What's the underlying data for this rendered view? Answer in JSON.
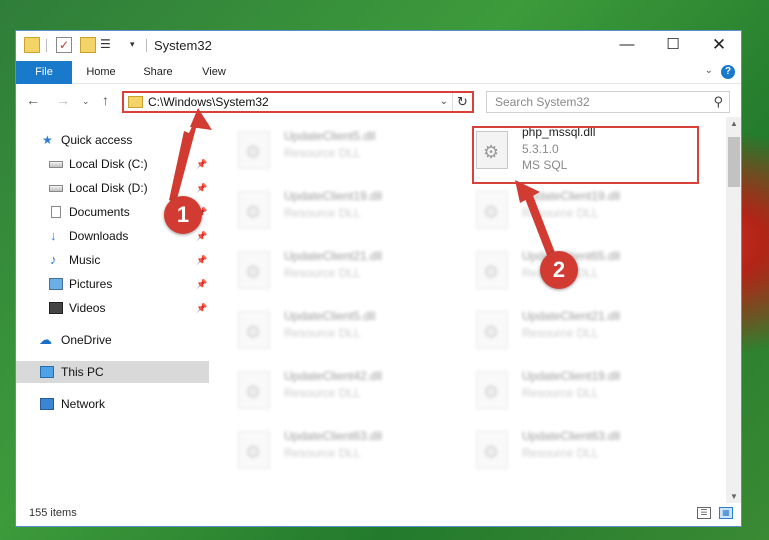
{
  "window": {
    "title": "System32",
    "controls": {
      "minimize": "—",
      "maximize": "☐",
      "close": "✕"
    }
  },
  "ribbon": {
    "tabs": [
      {
        "label": "File"
      },
      {
        "label": "Home"
      },
      {
        "label": "Share"
      },
      {
        "label": "View"
      }
    ],
    "help_label": "?"
  },
  "navigation": {
    "address": "C:\\Windows\\System32",
    "search_placeholder": "Search System32"
  },
  "sidebar": {
    "items": [
      {
        "label": "Quick access",
        "icon": "star-icon"
      },
      {
        "label": "Local Disk (C:)",
        "icon": "disk-icon",
        "pinned": true
      },
      {
        "label": "Local Disk (D:)",
        "icon": "disk-icon",
        "pinned": true
      },
      {
        "label": "Documents",
        "icon": "document-icon",
        "pinned": true
      },
      {
        "label": "Downloads",
        "icon": "download-icon",
        "pinned": true
      },
      {
        "label": "Music",
        "icon": "music-icon",
        "pinned": true
      },
      {
        "label": "Pictures",
        "icon": "pictures-icon",
        "pinned": true
      },
      {
        "label": "Videos",
        "icon": "video-icon",
        "pinned": true
      },
      {
        "label": "OneDrive",
        "icon": "cloud-icon"
      },
      {
        "label": "This PC",
        "icon": "computer-icon",
        "selected": true
      },
      {
        "label": "Network",
        "icon": "network-icon"
      }
    ]
  },
  "files": {
    "highlighted": {
      "name": "php_mssql.dll",
      "version": "5.3.1.0",
      "description": "MS SQL"
    },
    "left_column": [
      {
        "name": "UpdateClient5.dll",
        "type": "Resource DLL"
      },
      {
        "name": "UpdateClient19.dll",
        "type": "Resource DLL"
      },
      {
        "name": "UpdateClient21.dll",
        "type": "Resource DLL"
      },
      {
        "name": "UpdateClient5.dll",
        "type": "Resource DLL"
      },
      {
        "name": "UpdateClient42.dll",
        "type": "Resource DLL"
      },
      {
        "name": "UpdateClient63.dll",
        "type": "Resource DLL"
      }
    ],
    "right_column": [
      {
        "name": "UpdateClient19.dll",
        "type": "Resource DLL"
      },
      {
        "name": "UpdateClient65.dll",
        "type": "Resource DLL"
      },
      {
        "name": "UpdateClient21.dll",
        "type": "Resource DLL"
      },
      {
        "name": "UpdateClient19.dll",
        "type": "Resource DLL"
      },
      {
        "name": "UpdateClient63.dll",
        "type": "Resource DLL"
      }
    ]
  },
  "status": {
    "item_count": "155 items"
  },
  "annotations": {
    "step1": "1",
    "step2": "2",
    "color": "#d13b32"
  }
}
